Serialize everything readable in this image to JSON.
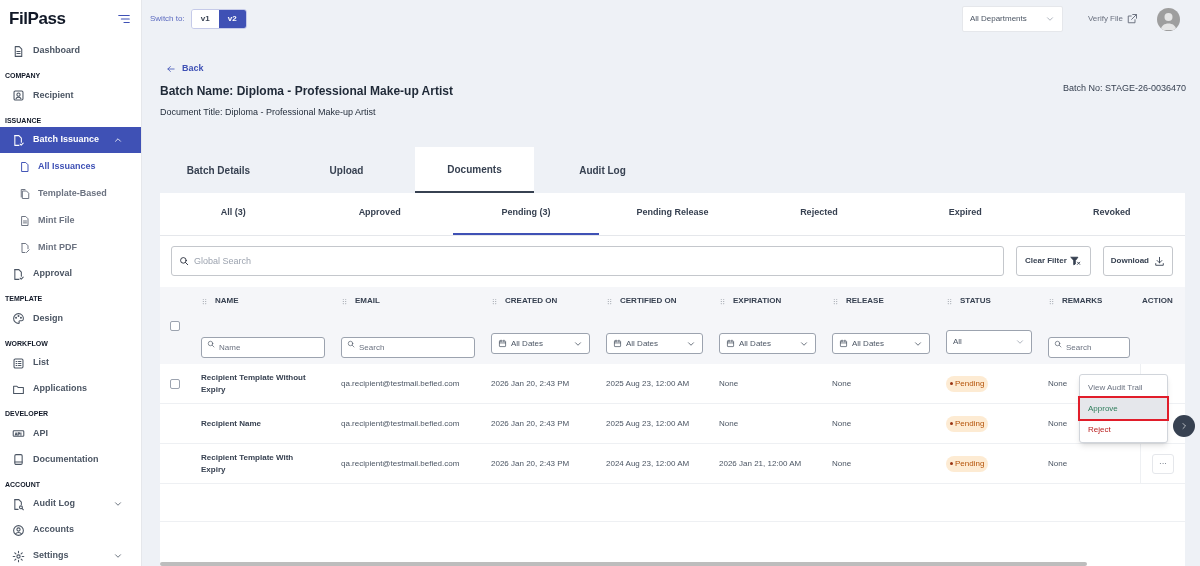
{
  "logo": {
    "text": "FilPass"
  },
  "sidebar": {
    "sections": [
      {
        "items": [
          {
            "label": "Dashboard",
            "selected": false
          }
        ]
      },
      {
        "heading": "COMPANY",
        "items": [
          {
            "label": "Recipient",
            "selected": false
          }
        ]
      },
      {
        "heading": "ISSUANCE",
        "items": [
          {
            "label": "Batch Issuance",
            "selected": true,
            "expanded": true,
            "children": [
              {
                "label": "All Issuances",
                "selected": true
              },
              {
                "label": "Template-Based",
                "selected": false
              },
              {
                "label": "Mint File",
                "selected": false
              },
              {
                "label": "Mint PDF",
                "selected": false
              }
            ]
          },
          {
            "label": "Approval",
            "selected": false
          }
        ]
      },
      {
        "heading": "TEMPLATE",
        "items": [
          {
            "label": "Design",
            "selected": false
          }
        ]
      },
      {
        "heading": "WORKFLOW",
        "items": [
          {
            "label": "List",
            "selected": false
          },
          {
            "label": "Applications",
            "selected": false
          }
        ]
      },
      {
        "heading": "DEVELOPER",
        "items": [
          {
            "label": "API",
            "selected": false
          },
          {
            "label": "Documentation",
            "selected": false
          }
        ]
      },
      {
        "heading": "ACCOUNT",
        "items": [
          {
            "label": "Audit Log",
            "selected": false,
            "expanded": false
          },
          {
            "label": "Accounts",
            "selected": false
          },
          {
            "label": "Settings",
            "selected": false,
            "expanded": false
          }
        ]
      }
    ]
  },
  "topbar": {
    "switch_label": "Switch to:",
    "versions": [
      {
        "label": "v1",
        "selected": false
      },
      {
        "label": "v2",
        "selected": true
      }
    ],
    "department": "All Departments",
    "verify_link": "Verify File"
  },
  "header": {
    "back": "Back",
    "batch_name": "Batch Name: Diploma - Professional Make-up Artist",
    "document_title": "Document Title: Diploma - Professional Make-up Artist",
    "batch_no": "Batch No: STAGE-26-0036470"
  },
  "tabs": [
    {
      "label": "Batch Details",
      "selected": false
    },
    {
      "label": "Upload",
      "selected": false
    },
    {
      "label": "Documents",
      "selected": true
    },
    {
      "label": "Audit Log",
      "selected": false
    }
  ],
  "subtabs": [
    {
      "label": "All (3)",
      "selected": false
    },
    {
      "label": "Approved",
      "selected": false
    },
    {
      "label": "Pending (3)",
      "selected": true
    },
    {
      "label": "Pending Release",
      "selected": false
    },
    {
      "label": "Rejected",
      "selected": false
    },
    {
      "label": "Expired",
      "selected": false
    },
    {
      "label": "Revoked",
      "selected": false
    }
  ],
  "search": {
    "placeholder": "Global Search"
  },
  "buttons": {
    "clear_filter": "Clear Filter",
    "download": "Download"
  },
  "table": {
    "columns": [
      {
        "label": "NAME",
        "filter": {
          "kind": "text",
          "placeholder": "Name"
        }
      },
      {
        "label": "EMAIL",
        "filter": {
          "kind": "text",
          "placeholder": "Search"
        }
      },
      {
        "label": "CREATED ON",
        "filter": {
          "kind": "date",
          "value": "All Dates"
        }
      },
      {
        "label": "CERTIFIED ON",
        "filter": {
          "kind": "date",
          "value": "All Dates"
        }
      },
      {
        "label": "EXPIRATION",
        "filter": {
          "kind": "date",
          "value": "All Dates"
        }
      },
      {
        "label": "RELEASE",
        "filter": {
          "kind": "date",
          "value": "All Dates"
        }
      },
      {
        "label": "STATUS",
        "filter": {
          "kind": "select",
          "value": "All"
        }
      },
      {
        "label": "REMARKS",
        "filter": {
          "kind": "text",
          "placeholder": "Search"
        }
      },
      {
        "label": "ACTION"
      }
    ],
    "header_checked": false,
    "rows": [
      {
        "checked": false,
        "cells": [
          "Recipient Template Without Expiry",
          "qa.recipient@testmail.befied.com",
          "2026 Jan 20, 2:43 PM",
          "2025 Aug 23, 12:00 AM",
          "None",
          "None",
          "Pending",
          "None"
        ]
      },
      {
        "cells": [
          "Recipient Name",
          "qa.recipient@testmail.befied.com",
          "2026 Jan 20, 2:43 PM",
          "2025 Aug 23, 12:00 AM",
          "None",
          "None",
          "Pending",
          "None"
        ]
      },
      {
        "cells": [
          "Recipient Template With Expiry",
          "qa.recipient@testmail.befied.com",
          "2026 Jan 20, 2:43 PM",
          "2024 Aug 23, 12:00 AM",
          "2026 Jan 21, 12:00 AM",
          "None",
          "Pending",
          "None"
        ],
        "action": "···"
      }
    ]
  },
  "action_menu": {
    "items": [
      {
        "label": "View Audit Trail",
        "kind": "view",
        "highlighted": false
      },
      {
        "label": "Approve",
        "kind": "approve",
        "highlighted": true
      },
      {
        "label": "Reject",
        "kind": "reject",
        "highlighted": false
      }
    ]
  }
}
